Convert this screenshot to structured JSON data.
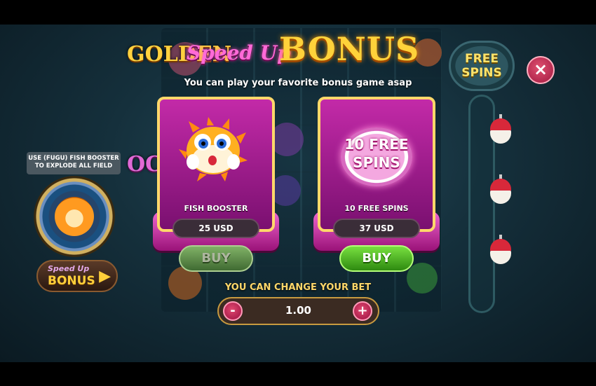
{
  "game": {
    "logo_line1": "GOLDEN",
    "logo_line2": "OCTOPUS"
  },
  "left_panel": {
    "booster_info": "USE (FUGU) FISH BOOSTER TO EXPLODE ALL FIELD",
    "speed_up_button": {
      "line1": "Speed Up",
      "line2": "BONUS",
      "arrow": "▶"
    }
  },
  "right_panel": {
    "free_spins_badge": "FREE SPINS",
    "close_symbol": "×"
  },
  "popup": {
    "title_part1": "Speed Up",
    "title_part2": "BONUS",
    "subtitle": "You can play your favorite bonus game asap",
    "options": [
      {
        "name": "FISH BOOSTER",
        "price": "25 USD",
        "buy_label": "BUY",
        "icon": "puffer-fish-icon"
      },
      {
        "name": "10 FREE SPINS",
        "price": "37 USD",
        "buy_label": "BUY",
        "icon_text_line1": "10 FREE",
        "icon_text_line2": "SPINS"
      }
    ],
    "bet": {
      "label": "YOU CAN CHANGE YOUR BET",
      "value": "1.00",
      "minus": "-",
      "plus": "+"
    }
  },
  "colors": {
    "card_gradient_top": "#c32aa8",
    "card_border": "#ffd86a",
    "buy_green": "#4cb828",
    "title_gold": "#ffd23a",
    "title_pink": "#ff6ad8"
  }
}
